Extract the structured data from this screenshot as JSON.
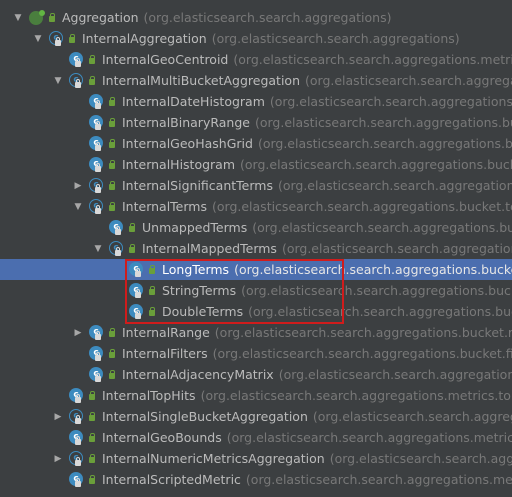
{
  "nodes": [
    {
      "name": "Aggregation",
      "pkg": "(org.elasticsearch.search.aggregations)",
      "arrow": "▼",
      "kind": "iface",
      "level": 0
    },
    {
      "name": "InternalAggregation",
      "pkg": "(org.elasticsearch.search.aggregations)",
      "arrow": "▼",
      "kind": "abstract",
      "level": 1
    },
    {
      "name": "InternalGeoCentroid",
      "pkg": "(org.elasticsearch.search.aggregations.metrics.geocentroid)",
      "arrow": "",
      "kind": "class",
      "level": 2
    },
    {
      "name": "InternalMultiBucketAggregation",
      "pkg": "(org.elasticsearch.search.aggregations)",
      "arrow": "▼",
      "kind": "abstract",
      "level": 2
    },
    {
      "name": "InternalDateHistogram",
      "pkg": "(org.elasticsearch.search.aggregations.bucket.histogram)",
      "arrow": "",
      "kind": "class",
      "level": 3
    },
    {
      "name": "InternalBinaryRange",
      "pkg": "(org.elasticsearch.search.aggregations.bucket.range)",
      "arrow": "",
      "kind": "class",
      "level": 3
    },
    {
      "name": "InternalGeoHashGrid",
      "pkg": "(org.elasticsearch.search.aggregations.bucket.geogrid)",
      "arrow": "",
      "kind": "class",
      "level": 3
    },
    {
      "name": "InternalHistogram",
      "pkg": "(org.elasticsearch.search.aggregations.bucket.histogram)",
      "arrow": "",
      "kind": "class",
      "level": 3
    },
    {
      "name": "InternalSignificantTerms",
      "pkg": "(org.elasticsearch.search.aggregations.bucket.significant)",
      "arrow": "▶",
      "kind": "abstract",
      "level": 3
    },
    {
      "name": "InternalTerms",
      "pkg": "(org.elasticsearch.search.aggregations.bucket.terms)",
      "arrow": "▼",
      "kind": "abstract",
      "level": 3
    },
    {
      "name": "UnmappedTerms",
      "pkg": "(org.elasticsearch.search.aggregations.bucket.terms)",
      "arrow": "",
      "kind": "class",
      "level": 4
    },
    {
      "name": "InternalMappedTerms",
      "pkg": "(org.elasticsearch.search.aggregations.bucket.terms)",
      "arrow": "▼",
      "kind": "abstract",
      "level": 4
    },
    {
      "name": "LongTerms",
      "pkg": "(org.elasticsearch.search.aggregations.bucket.terms)",
      "arrow": "",
      "kind": "class",
      "level": 5,
      "selected": true
    },
    {
      "name": "StringTerms",
      "pkg": "(org.elasticsearch.search.aggregations.bucket.terms)",
      "arrow": "",
      "kind": "class",
      "level": 5
    },
    {
      "name": "DoubleTerms",
      "pkg": "(org.elasticsearch.search.aggregations.bucket.terms)",
      "arrow": "",
      "kind": "class",
      "level": 5
    },
    {
      "name": "InternalRange",
      "pkg": "(org.elasticsearch.search.aggregations.bucket.range)",
      "arrow": "▶",
      "kind": "class",
      "level": 3
    },
    {
      "name": "InternalFilters",
      "pkg": "(org.elasticsearch.search.aggregations.bucket.filters)",
      "arrow": "",
      "kind": "class",
      "level": 3
    },
    {
      "name": "InternalAdjacencyMatrix",
      "pkg": "(org.elasticsearch.search.aggregations.bucket.adjacency)",
      "arrow": "",
      "kind": "class",
      "level": 3
    },
    {
      "name": "InternalTopHits",
      "pkg": "(org.elasticsearch.search.aggregations.metrics.tophits)",
      "arrow": "",
      "kind": "class",
      "level": 2
    },
    {
      "name": "InternalSingleBucketAggregation",
      "pkg": "(org.elasticsearch.search.aggregations)",
      "arrow": "▶",
      "kind": "abstract",
      "level": 2
    },
    {
      "name": "InternalGeoBounds",
      "pkg": "(org.elasticsearch.search.aggregations.metrics.geobounds)",
      "arrow": "",
      "kind": "class",
      "level": 2
    },
    {
      "name": "InternalNumericMetricsAggregation",
      "pkg": "(org.elasticsearch.search.aggregations)",
      "arrow": "▶",
      "kind": "abstract",
      "level": 2
    },
    {
      "name": "InternalScriptedMetric",
      "pkg": "(org.elasticsearch.search.aggregations.metrics.scripted)",
      "arrow": "",
      "kind": "class",
      "level": 2
    }
  ],
  "colors": {
    "background": "#3c3f41",
    "selection": "#4b6eaf",
    "highlight_box": "#d01c1c",
    "class_icon": "#3d8bbf"
  }
}
